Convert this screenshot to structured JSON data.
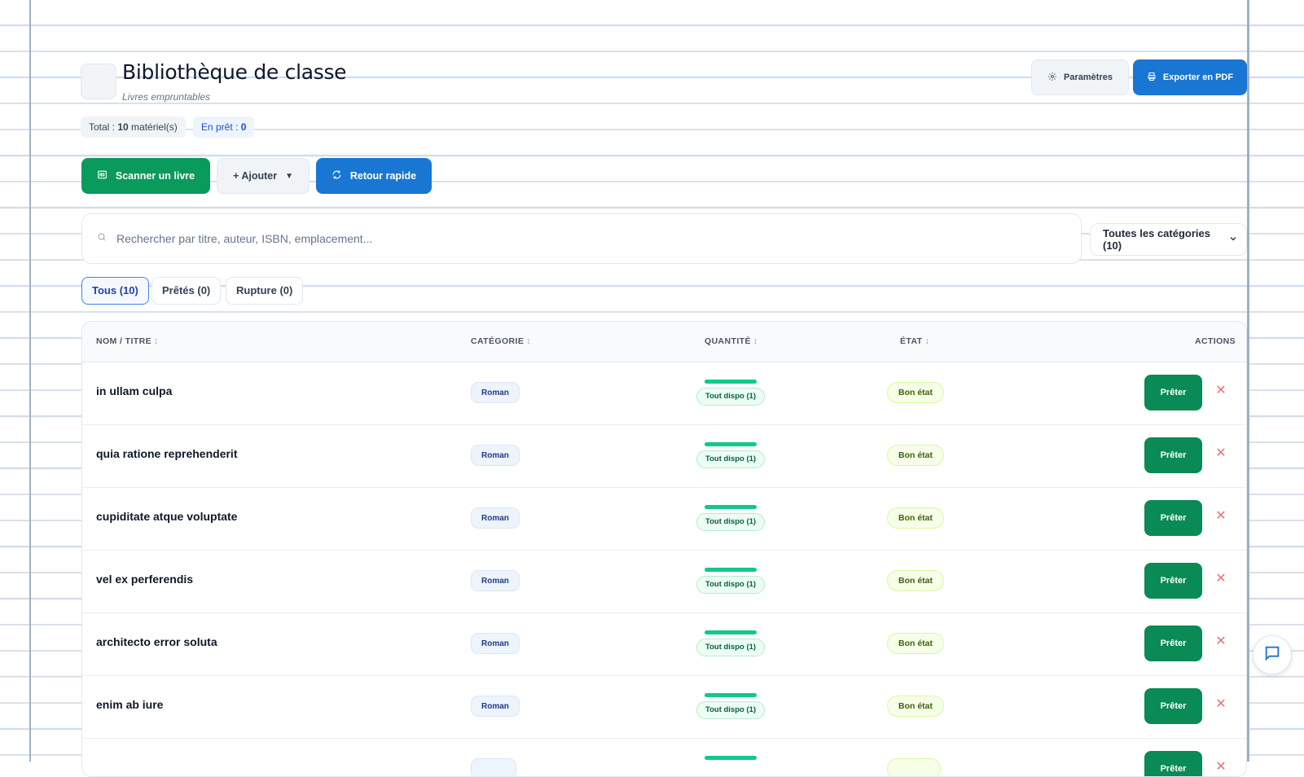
{
  "header": {
    "title": "Bibliothèque de classe",
    "subtitle": "Livres empruntables",
    "stats": {
      "total_prefix": "Total : ",
      "total_value": "10",
      "total_suffix": " matériel(s)",
      "loan_prefix": "En prêt : ",
      "loan_value": "0"
    },
    "settings_label": "Paramètres",
    "export_label": "Exporter en PDF"
  },
  "toolbar": {
    "scan_label": "Scanner un livre",
    "add_label": "+ Ajouter",
    "add_caret": "▼",
    "return_label": "Retour rapide"
  },
  "search": {
    "placeholder": "Rechercher par titre, auteur, ISBN, emplacement..."
  },
  "category_filter": {
    "selected": "Toutes les catégories (10)"
  },
  "tabs": [
    {
      "label": "Tous (10)",
      "active": true
    },
    {
      "label": "Prêtés (0)",
      "active": false
    },
    {
      "label": "Rupture (0)",
      "active": false
    }
  ],
  "table": {
    "columns": {
      "name": "NOM / TITRE",
      "category": "CATÉGORIE",
      "quantity": "QUANTITÉ",
      "state": "ÉTAT",
      "actions": "ACTIONS"
    },
    "sort_symbol": "↕",
    "lend_label": "Prêter",
    "rows": [
      {
        "name": "in ullam culpa",
        "category": "Roman",
        "quantity": "Tout dispo (1)",
        "availability_fraction": 1,
        "state": "Bon état"
      },
      {
        "name": "quia ratione reprehenderit",
        "category": "Roman",
        "quantity": "Tout dispo (1)",
        "availability_fraction": 1,
        "state": "Bon état"
      },
      {
        "name": "cupiditate atque voluptate",
        "category": "Roman",
        "quantity": "Tout dispo (1)",
        "availability_fraction": 1,
        "state": "Bon état"
      },
      {
        "name": "vel ex perferendis",
        "category": "Roman",
        "quantity": "Tout dispo (1)",
        "availability_fraction": 1,
        "state": "Bon état"
      },
      {
        "name": "architecto error soluta",
        "category": "Roman",
        "quantity": "Tout dispo (1)",
        "availability_fraction": 1,
        "state": "Bon état"
      },
      {
        "name": "enim ab iure",
        "category": "Roman",
        "quantity": "Tout dispo (1)",
        "availability_fraction": 1,
        "state": "Bon état"
      },
      {
        "name": "",
        "category": "",
        "quantity": "",
        "availability_fraction": 1,
        "state": ""
      }
    ]
  },
  "colors": {
    "primary_green": "#0a8a55",
    "primary_blue": "#1976d2",
    "availability_green": "#10c98a"
  },
  "icons": {
    "settings": "gear-icon",
    "export": "printer-icon",
    "scan": "barcode-icon",
    "return": "refresh-icon",
    "search": "search-icon",
    "dropdown": "chevron-down-icon",
    "delete": "close-icon",
    "chat": "chat-icon"
  }
}
